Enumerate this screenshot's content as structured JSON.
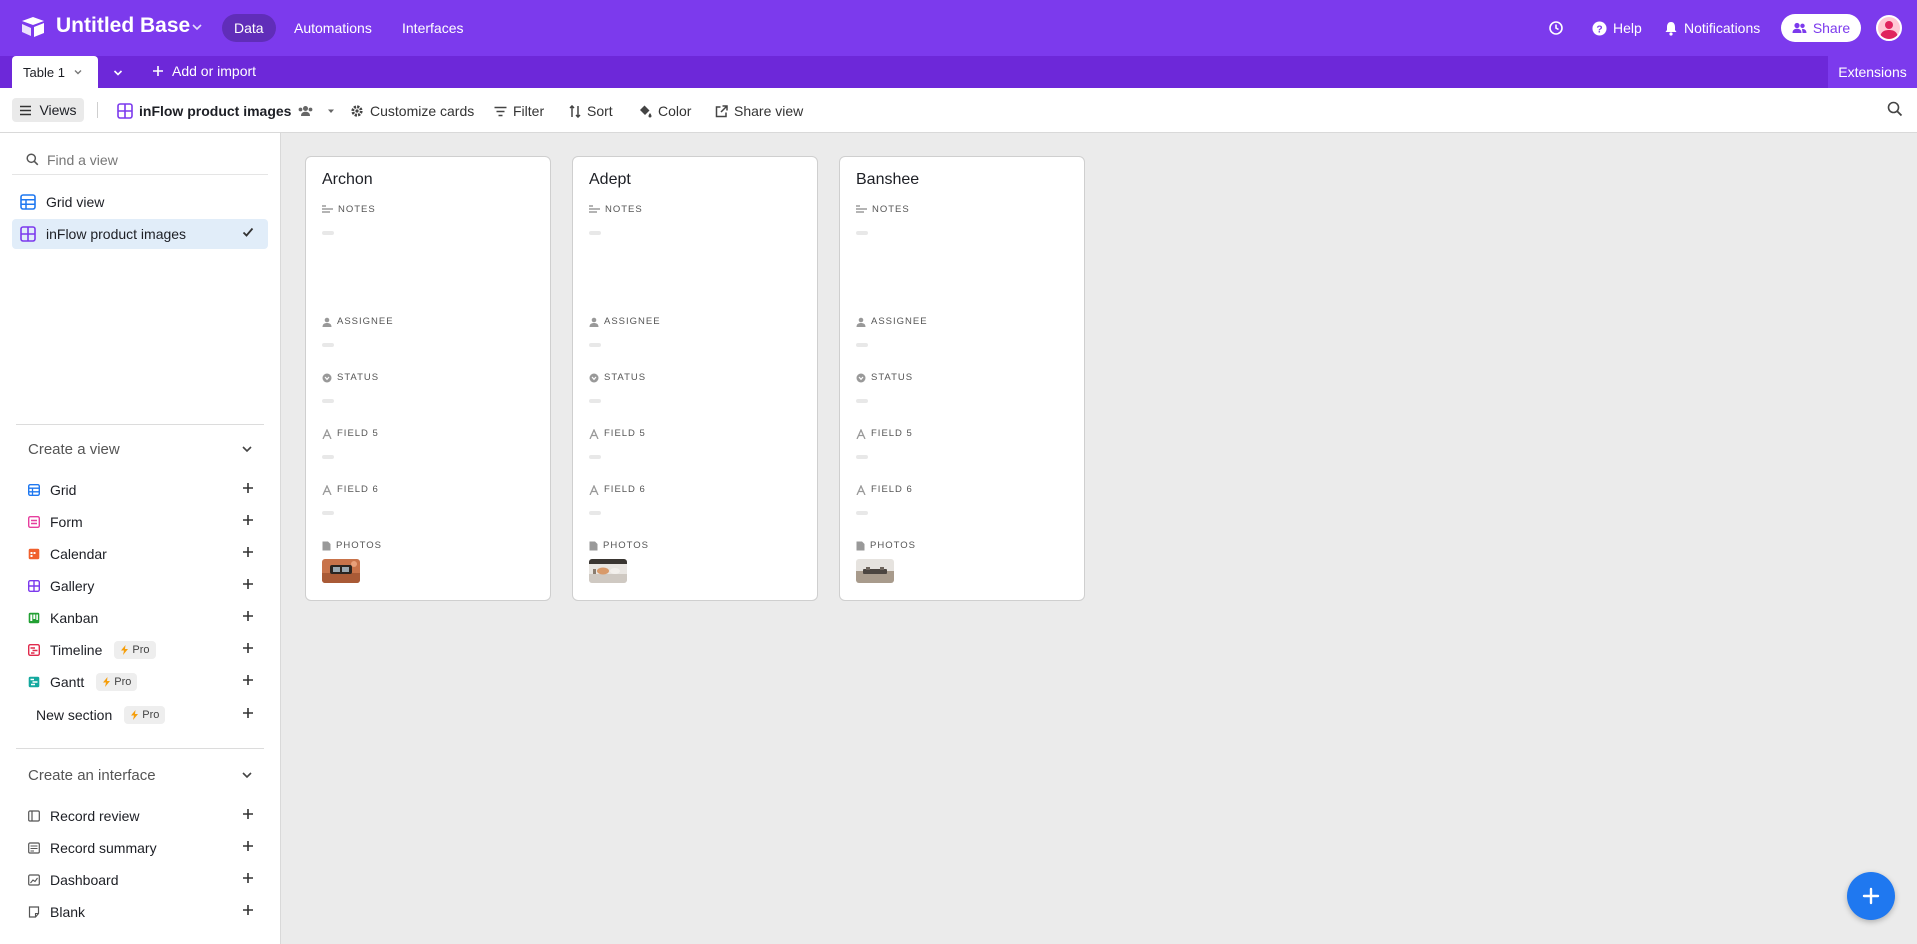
{
  "header": {
    "base_title": "Untitled Base",
    "tabs": [
      {
        "label": "Data",
        "active": true
      },
      {
        "label": "Automations",
        "active": false
      },
      {
        "label": "Interfaces",
        "active": false
      }
    ],
    "help_label": "Help",
    "notifications_label": "Notifications",
    "share_label": "Share",
    "brand_color": "#7c3aed"
  },
  "tabrow": {
    "table_tab_label": "Table 1",
    "add_import_label": "Add or import",
    "extensions_label": "Extensions"
  },
  "toolbar": {
    "views_label": "Views",
    "current_view_label": "inFlow product images",
    "customize_cards_label": "Customize cards",
    "filter_label": "Filter",
    "sort_label": "Sort",
    "color_label": "Color",
    "share_view_label": "Share view"
  },
  "sidebar": {
    "find_placeholder": "Find a view",
    "views": [
      {
        "label": "Grid view",
        "icon": "grid-view-icon",
        "selected": false
      },
      {
        "label": "inFlow product images",
        "icon": "gallery-view-icon",
        "selected": true
      }
    ],
    "create_view_title": "Create a view",
    "create_view_items": [
      {
        "label": "Grid",
        "icon": "grid-icon",
        "color": "#1f78f0",
        "pro": false
      },
      {
        "label": "Form",
        "icon": "form-icon",
        "color": "#e63e9e",
        "pro": false
      },
      {
        "label": "Calendar",
        "icon": "calendar-icon",
        "color": "#f0602d",
        "pro": false
      },
      {
        "label": "Gallery",
        "icon": "gallery-icon",
        "color": "#7c3aed",
        "pro": false
      },
      {
        "label": "Kanban",
        "icon": "kanban-icon",
        "color": "#22a033",
        "pro": false
      },
      {
        "label": "Timeline",
        "icon": "timeline-icon",
        "color": "#e02a4c",
        "pro": true
      },
      {
        "label": "Gantt",
        "icon": "gantt-icon",
        "color": "#13a89e",
        "pro": true
      }
    ],
    "new_section_label": "New section",
    "pro_label": "Pro",
    "create_interface_title": "Create an interface",
    "interface_items": [
      {
        "label": "Record review",
        "icon": "record-review-icon"
      },
      {
        "label": "Record summary",
        "icon": "record-summary-icon"
      },
      {
        "label": "Dashboard",
        "icon": "dashboard-icon"
      },
      {
        "label": "Blank",
        "icon": "blank-icon"
      }
    ]
  },
  "fields": {
    "notes": "NOTES",
    "assignee": "ASSIGNEE",
    "status": "STATUS",
    "field5": "FIELD 5",
    "field6": "FIELD 6",
    "photos": "PHOTOS"
  },
  "cards": [
    {
      "title": "Archon",
      "photo": "orange product photo thumbnail"
    },
    {
      "title": "Adept",
      "photo": "light product photo thumbnail"
    },
    {
      "title": "Banshee",
      "photo": "grey product photo thumbnail"
    }
  ]
}
